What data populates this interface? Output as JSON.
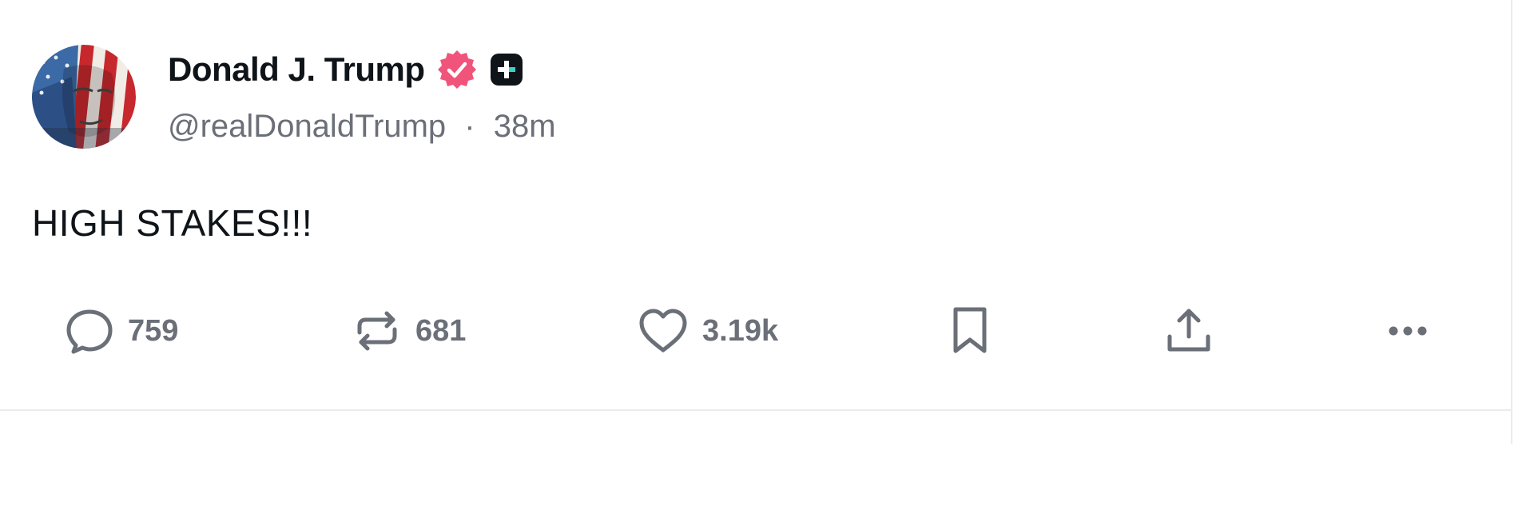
{
  "post": {
    "author": {
      "display_name": "Donald J. Trump",
      "handle": "@realDonaldTrump",
      "verified_badge_icon": "verified-icon",
      "plus_badge_icon": "plus-badge-icon"
    },
    "time_separator": "·",
    "timestamp": "38m",
    "text": "HIGH STAKES!!!",
    "actions": {
      "reply": {
        "icon": "comment-icon",
        "count": "759"
      },
      "repost": {
        "icon": "repost-icon",
        "count": "681"
      },
      "like": {
        "icon": "heart-icon",
        "count": "3.19k"
      },
      "bookmark": {
        "icon": "bookmark-icon"
      },
      "share": {
        "icon": "share-icon"
      },
      "more": {
        "icon": "more-icon"
      }
    }
  },
  "colors": {
    "text_primary": "#0f1419",
    "text_secondary": "#6b6f78",
    "verified_badge": "#f0547a",
    "divider": "#ebebeb"
  }
}
